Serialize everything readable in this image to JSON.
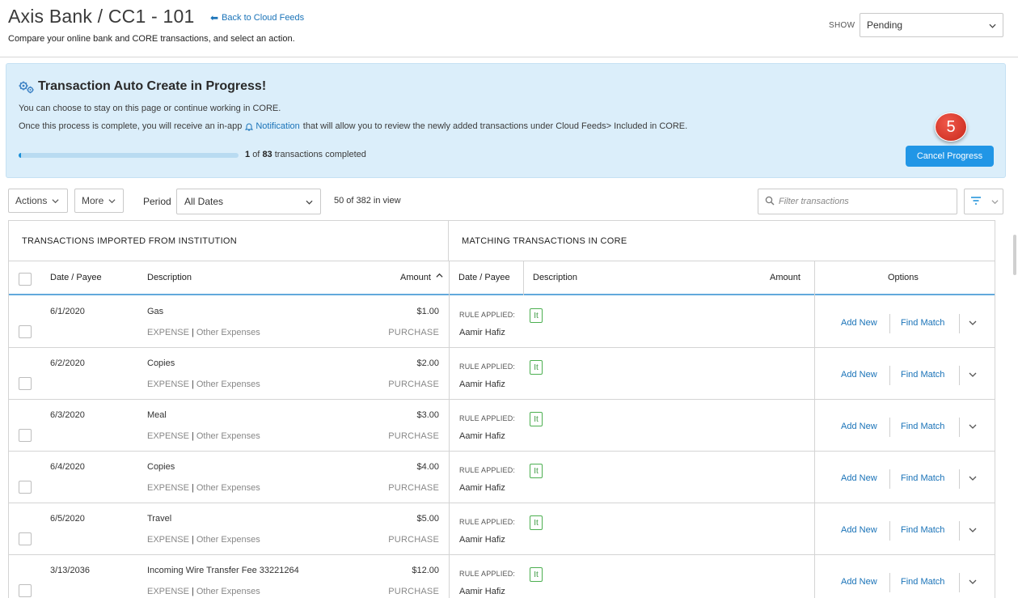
{
  "header": {
    "title": "Axis Bank / CC1 - 101",
    "back_link": "Back to Cloud Feeds",
    "subtitle": "Compare your online bank and CORE transactions, and select an action.",
    "show_label": "SHOW",
    "show_value": "Pending"
  },
  "banner": {
    "title": "Transaction Auto Create in Progress!",
    "line1": "You can choose to stay on this page or continue working in CORE.",
    "line2_before": "Once this process is complete, you will receive an in-app",
    "line2_link": "Notification",
    "line2_after": "that will allow you to review the newly added transactions under Cloud Feeds> Included in CORE.",
    "progress_done": "1",
    "progress_of": "of",
    "progress_total": "83",
    "progress_suffix": "transactions completed",
    "progress_fraction": 0.012,
    "cancel_label": "Cancel Progress",
    "step_badge": "5"
  },
  "toolbar": {
    "actions_label": "Actions",
    "more_label": "More",
    "period_label": "Period",
    "period_value": "All Dates",
    "view_count": "50 of 382 in view",
    "filter_placeholder": "Filter transactions"
  },
  "table": {
    "left_section_title": "TRANSACTIONS IMPORTED FROM INSTITUTION",
    "right_section_title": "MATCHING TRANSACTIONS IN CORE",
    "columns": {
      "date_payee": "Date / Payee",
      "description": "Description",
      "amount": "Amount",
      "core_date_payee": "Date / Payee",
      "core_description": "Description",
      "core_amount": "Amount",
      "options": "Options"
    },
    "rule_label": "RULE APPLIED:",
    "rule_tag": "It",
    "add_new_label": "Add New",
    "find_match_label": "Find Match",
    "rows": [
      {
        "date": "6/1/2020",
        "payee": "Gas",
        "amount": "$1.00",
        "category": "EXPENSE",
        "subcategory": "Other Expenses",
        "type": "PURCHASE",
        "matched": "Aamir Hafiz"
      },
      {
        "date": "6/2/2020",
        "payee": "Copies",
        "amount": "$2.00",
        "category": "EXPENSE",
        "subcategory": "Other Expenses",
        "type": "PURCHASE",
        "matched": "Aamir Hafiz"
      },
      {
        "date": "6/3/2020",
        "payee": "Meal",
        "amount": "$3.00",
        "category": "EXPENSE",
        "subcategory": "Other Expenses",
        "type": "PURCHASE",
        "matched": "Aamir Hafiz"
      },
      {
        "date": "6/4/2020",
        "payee": "Copies",
        "amount": "$4.00",
        "category": "EXPENSE",
        "subcategory": "Other Expenses",
        "type": "PURCHASE",
        "matched": "Aamir Hafiz"
      },
      {
        "date": "6/5/2020",
        "payee": "Travel",
        "amount": "$5.00",
        "category": "EXPENSE",
        "subcategory": "Other Expenses",
        "type": "PURCHASE",
        "matched": "Aamir Hafiz"
      },
      {
        "date": "3/13/2036",
        "payee": "Incoming Wire Transfer Fee 33221264",
        "amount": "$12.00",
        "category": "EXPENSE",
        "subcategory": "Other Expenses",
        "type": "PURCHASE",
        "matched": "Aamir Hafiz"
      }
    ]
  }
}
